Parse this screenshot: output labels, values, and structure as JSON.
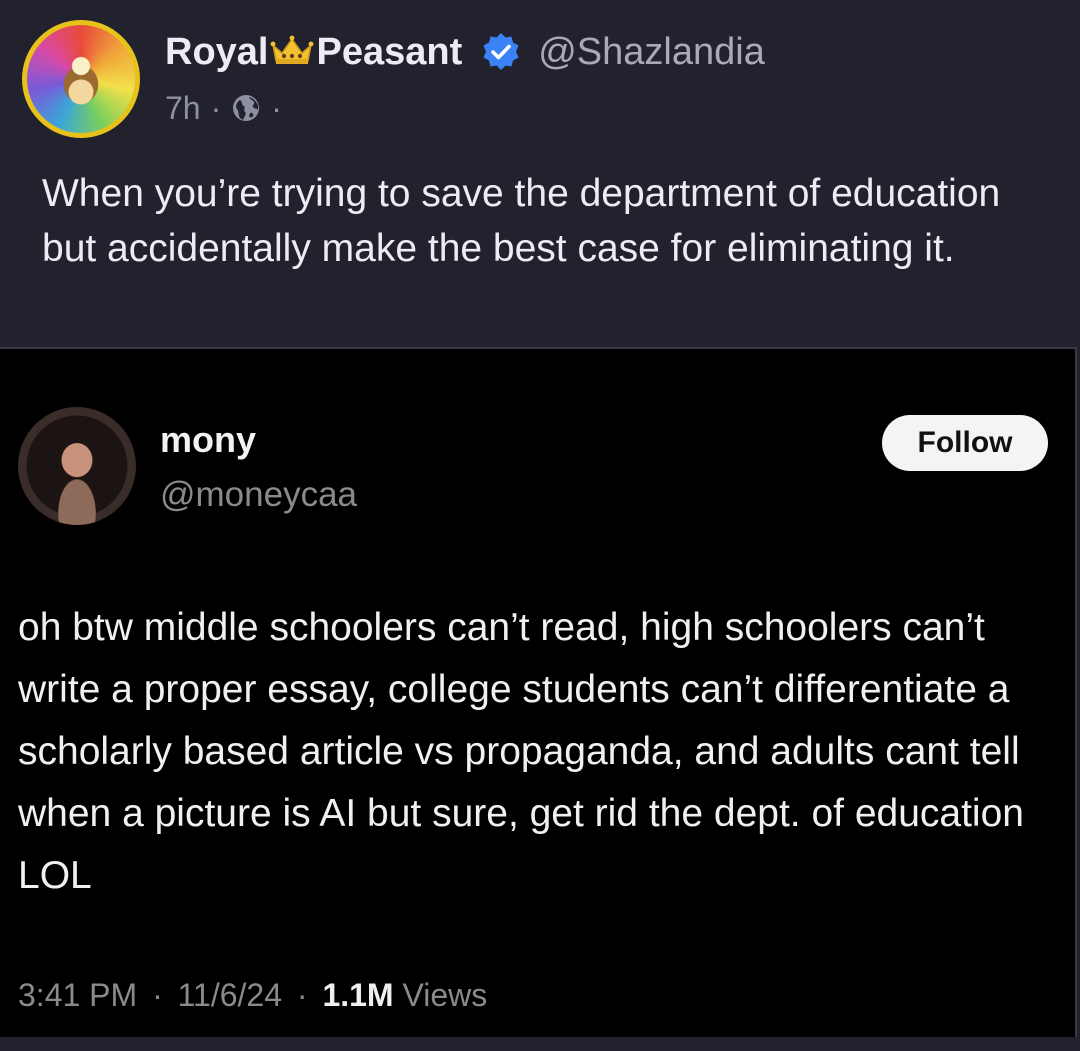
{
  "post": {
    "display_name_part1": "Royal",
    "display_name_part2": "Peasant",
    "crown_icon": "crown-icon",
    "verified_icon": "verified-badge-icon",
    "handle": "@Shazlandia",
    "time": "7h",
    "separator": "·",
    "visibility_icon": "globe-icon",
    "text": "When you’re trying to save the department of education but accidentally make the best case for eliminating it.",
    "colors": {
      "background": "#22222f",
      "verified": "#3b82f6",
      "avatar_ring": "#e6c21a"
    }
  },
  "embedded_tweet": {
    "name": "mony",
    "handle": "@moneycaa",
    "follow_label": "Follow",
    "text": "oh btw middle schoolers can’t read, high schoolers can’t write a proper essay, college students can’t differentiate a scholarly based article vs propaganda, and adults cant tell when a picture is AI but sure, get rid the dept. of education LOL",
    "time": "3:41 PM",
    "date": "11/6/24",
    "separator": "·",
    "views_count": "1.1M",
    "views_label": "Views"
  }
}
